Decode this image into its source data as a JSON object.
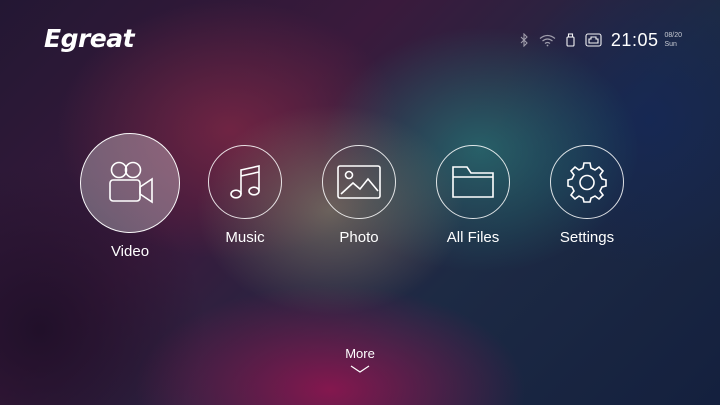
{
  "brand": {
    "logo_text": "Egreat"
  },
  "status_bar": {
    "icons": [
      "bluetooth-icon",
      "wifi-icon",
      "usb-drive-icon",
      "network-icon"
    ],
    "time": "21:05",
    "date": "08/20",
    "day": "Sun"
  },
  "menu": {
    "selected": "video",
    "items": [
      {
        "id": "video",
        "label": "Video",
        "icon": "video-camera-icon"
      },
      {
        "id": "music",
        "label": "Music",
        "icon": "music-note-icon"
      },
      {
        "id": "photo",
        "label": "Photo",
        "icon": "photo-icon"
      },
      {
        "id": "all_files",
        "label": "All Files",
        "icon": "folder-icon"
      },
      {
        "id": "settings",
        "label": "Settings",
        "icon": "gear-icon"
      }
    ]
  },
  "more": {
    "label": "More"
  },
  "colors": {
    "text": "#ffffff",
    "ring": "#ffffff",
    "selected_fill": "rgba(255,255,255,0.30)"
  }
}
